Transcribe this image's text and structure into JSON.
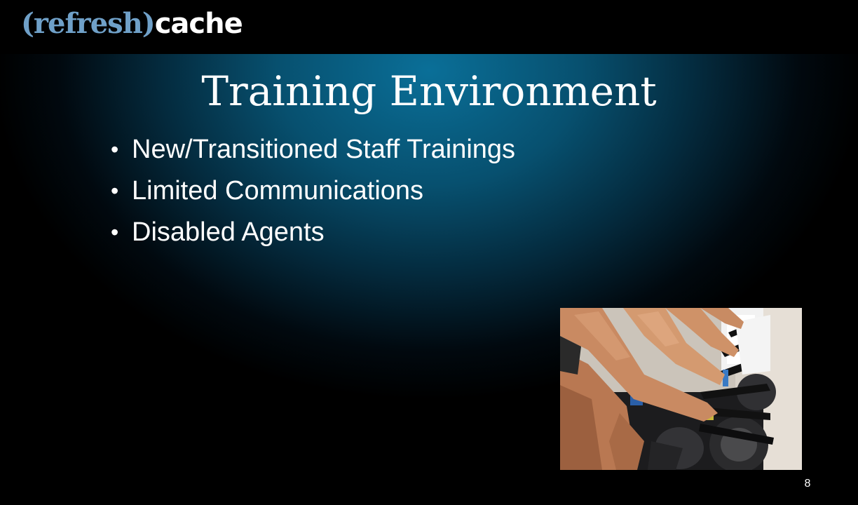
{
  "header": {
    "logo_refresh": "(refresh)",
    "logo_cache": "cache"
  },
  "slide": {
    "title": "Training Environment",
    "bullets": [
      "New/Transitioned Staff Trainings",
      "Limited Communications",
      "Disabled Agents"
    ],
    "page_number": "8"
  },
  "photo": {
    "icon": "spin-class-photo"
  },
  "colors": {
    "logo_accent": "#6fa0c8",
    "background_glow": "#0a6f98",
    "text": "#ffffff"
  }
}
